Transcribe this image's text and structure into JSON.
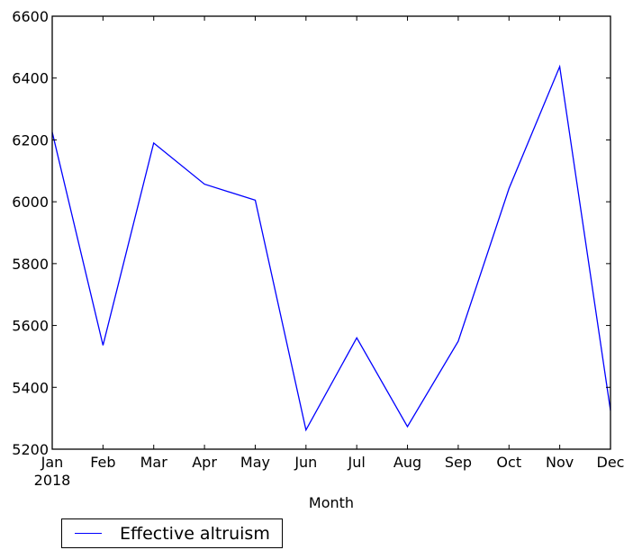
{
  "chart_data": {
    "type": "line",
    "title": "",
    "xlabel": "Month",
    "ylabel": "",
    "categories": [
      "Jan",
      "Feb",
      "Mar",
      "Apr",
      "May",
      "Jun",
      "Jul",
      "Aug",
      "Sep",
      "Oct",
      "Nov",
      "Dec"
    ],
    "x_tick_labels": [
      "Jan",
      "Feb",
      "Mar",
      "Apr",
      "May",
      "Jun",
      "Jul",
      "Aug",
      "Sep",
      "Oct",
      "Nov",
      "Dec"
    ],
    "x_tick_sublabel": "2018",
    "y_ticks": [
      5200,
      5400,
      5600,
      5800,
      6000,
      6200,
      6400,
      6600
    ],
    "ylim": [
      5200,
      6600
    ],
    "grid": false,
    "legend_position": "bottom-left (below axes)",
    "series": [
      {
        "name": "Effective altruism",
        "color": "#0000ff",
        "values": [
          6225,
          5536,
          6190,
          6057,
          6005,
          5262,
          5560,
          5273,
          5549,
          6043,
          6437,
          5325
        ]
      }
    ]
  },
  "legend": {
    "items": [
      {
        "label": "Effective altruism",
        "color": "#0000ff"
      }
    ]
  }
}
